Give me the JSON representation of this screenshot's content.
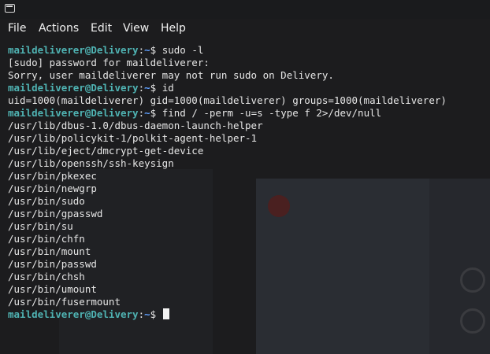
{
  "menu": {
    "items": [
      "File",
      "Actions",
      "Edit",
      "View",
      "Help"
    ]
  },
  "prompt": {
    "user_host": "maildeliverer@Delivery",
    "sep": ":",
    "path": "~",
    "symbol": "$"
  },
  "lines": [
    {
      "type": "prompt",
      "cmd": " sudo -l"
    },
    {
      "type": "out",
      "text": "[sudo] password for maildeliverer:"
    },
    {
      "type": "out",
      "text": "Sorry, user maildeliverer may not run sudo on Delivery."
    },
    {
      "type": "prompt",
      "cmd": " id"
    },
    {
      "type": "out",
      "text": "uid=1000(maildeliverer) gid=1000(maildeliverer) groups=1000(maildeliverer)"
    },
    {
      "type": "prompt",
      "cmd": " find / -perm -u=s -type f 2>/dev/null"
    },
    {
      "type": "out",
      "text": "/usr/lib/dbus-1.0/dbus-daemon-launch-helper"
    },
    {
      "type": "out",
      "text": "/usr/lib/policykit-1/polkit-agent-helper-1"
    },
    {
      "type": "out",
      "text": "/usr/lib/eject/dmcrypt-get-device"
    },
    {
      "type": "out",
      "text": "/usr/lib/openssh/ssh-keysign"
    },
    {
      "type": "out",
      "text": "/usr/bin/pkexec"
    },
    {
      "type": "out",
      "text": "/usr/bin/newgrp"
    },
    {
      "type": "out",
      "text": "/usr/bin/sudo"
    },
    {
      "type": "out",
      "text": "/usr/bin/gpasswd"
    },
    {
      "type": "out",
      "text": "/usr/bin/su"
    },
    {
      "type": "out",
      "text": "/usr/bin/chfn"
    },
    {
      "type": "out",
      "text": "/usr/bin/mount"
    },
    {
      "type": "out",
      "text": "/usr/bin/passwd"
    },
    {
      "type": "out",
      "text": "/usr/bin/chsh"
    },
    {
      "type": "out",
      "text": "/usr/bin/umount"
    },
    {
      "type": "out",
      "text": "/usr/bin/fusermount"
    },
    {
      "type": "prompt",
      "cmd": " ",
      "cursor": true
    }
  ],
  "colors": {
    "background": "#1c1c1e",
    "user": "#4fb3b3",
    "path": "#5fa0ff",
    "text": "#e6e6e6"
  }
}
